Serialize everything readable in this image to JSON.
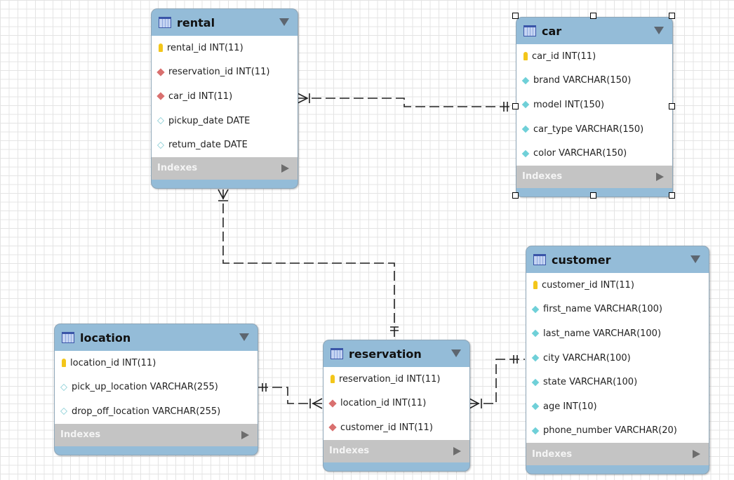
{
  "indexes_label": "Indexes",
  "tables": {
    "rental": {
      "name": "rental",
      "columns": [
        {
          "icon": "primary-key-icon",
          "text": "rental_id INT(11)"
        },
        {
          "icon": "foreign-key-icon",
          "text": "reservation_id INT(11)"
        },
        {
          "icon": "foreign-key-icon",
          "text": "car_id INT(11)"
        },
        {
          "icon": "nullable-column-icon",
          "text": "pickup_date DATE"
        },
        {
          "icon": "nullable-column-icon",
          "text": "retum_date DATE"
        }
      ]
    },
    "car": {
      "name": "car",
      "selected": true,
      "columns": [
        {
          "icon": "primary-key-icon",
          "text": "car_id INT(11)"
        },
        {
          "icon": "column-icon",
          "text": "brand VARCHAR(150)"
        },
        {
          "icon": "column-icon",
          "text": "model INT(150)"
        },
        {
          "icon": "column-icon",
          "text": "car_type VARCHAR(150)"
        },
        {
          "icon": "column-icon",
          "text": "color VARCHAR(150)"
        }
      ]
    },
    "customer": {
      "name": "customer",
      "columns": [
        {
          "icon": "primary-key-icon",
          "text": "customer_id INT(11)"
        },
        {
          "icon": "column-icon",
          "text": "first_name VARCHAR(100)"
        },
        {
          "icon": "column-icon",
          "text": "last_name VARCHAR(100)"
        },
        {
          "icon": "column-icon",
          "text": "city VARCHAR(100)"
        },
        {
          "icon": "column-icon",
          "text": "state VARCHAR(100)"
        },
        {
          "icon": "column-icon",
          "text": "age INT(10)"
        },
        {
          "icon": "column-icon",
          "text": "phone_number VARCHAR(20)"
        }
      ]
    },
    "location": {
      "name": "location",
      "columns": [
        {
          "icon": "primary-key-icon",
          "text": "location_id INT(11)"
        },
        {
          "icon": "nullable-column-icon",
          "text": "pick_up_location VARCHAR(255)"
        },
        {
          "icon": "nullable-column-icon",
          "text": "drop_off_location VARCHAR(255)"
        }
      ]
    },
    "reservation": {
      "name": "reservation",
      "columns": [
        {
          "icon": "primary-key-icon",
          "text": "reservation_id INT(11)"
        },
        {
          "icon": "foreign-key-icon",
          "text": "location_id INT(11)"
        },
        {
          "icon": "foreign-key-icon",
          "text": "customer_id INT(11)"
        }
      ]
    }
  },
  "relationships": [
    {
      "from": "rental",
      "to": "car",
      "type": "many-to-one"
    },
    {
      "from": "rental",
      "to": "reservation",
      "type": "many-to-one"
    },
    {
      "from": "reservation",
      "to": "location",
      "type": "many-to-one"
    },
    {
      "from": "reservation",
      "to": "customer",
      "type": "many-to-one"
    }
  ]
}
